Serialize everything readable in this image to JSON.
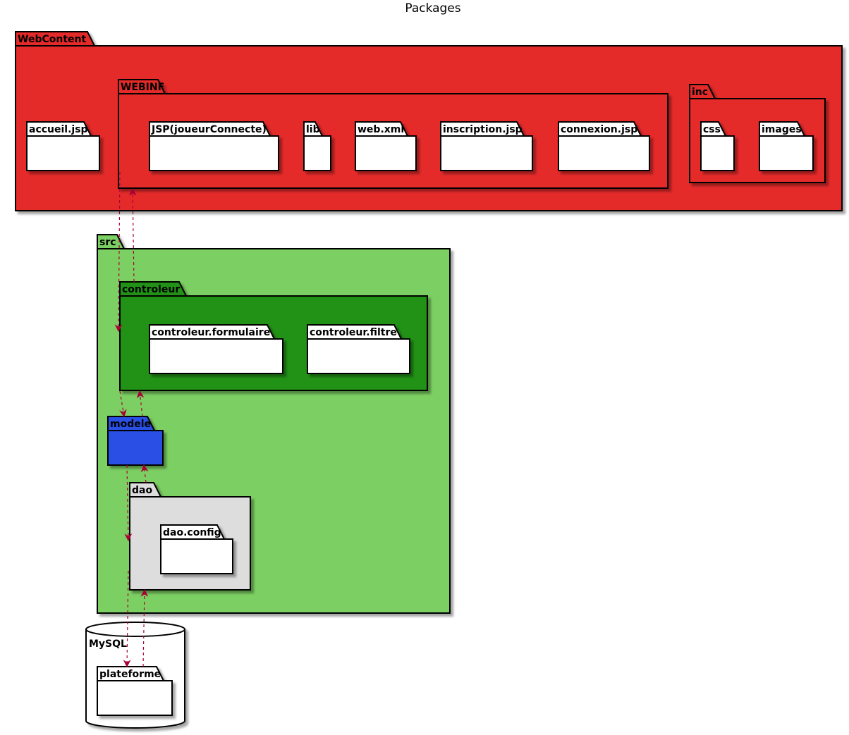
{
  "title": "Packages",
  "colors": {
    "webcontent": "#E52A2A",
    "src": "#7BCF62",
    "controleur": "#229214",
    "modele": "#2A4FE5",
    "dao": "#DDDDDD",
    "leaf": "#FFFFFF",
    "arrow": "#A80036",
    "border": "#000000"
  },
  "packages": {
    "webcontent": "WebContent",
    "accueil": "accueil.jsp",
    "webinf": "WEBINF",
    "jsp": "JSP(joueurConnecte)",
    "lib": "lib",
    "webxml": "web.xml",
    "inscription": "inscription.jsp",
    "connexion": "connexion.jsp",
    "inc": "inc",
    "css": "css",
    "images": "images",
    "src": "src",
    "controleur": "controleur",
    "formulaire": "controleur.formulaire",
    "filtre": "controleur.filtre",
    "modele": "modele",
    "dao": "dao",
    "daoconfig": "dao.config",
    "mysql": "MySQL",
    "plateforme": "plateforme"
  }
}
